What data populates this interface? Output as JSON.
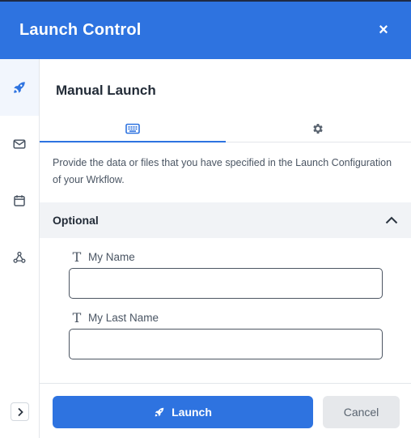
{
  "header": {
    "title": "Launch Control",
    "close_label": "×"
  },
  "sidebar": {
    "items": [
      {
        "icon": "rocket-icon",
        "active": true
      },
      {
        "icon": "mail-icon",
        "active": false
      },
      {
        "icon": "calendar-icon",
        "active": false
      },
      {
        "icon": "webhook-icon",
        "active": false
      }
    ],
    "expand_icon": "chevron-right-icon"
  },
  "main": {
    "title": "Manual Launch",
    "tabs": [
      {
        "icon": "keyboard-icon",
        "active": true
      },
      {
        "icon": "gear-icon",
        "active": false
      }
    ],
    "description": "Provide the data or files that you have specified in the Launch Configuration of your Wrkflow.",
    "section": {
      "title": "Optional",
      "expanded": true,
      "fields": [
        {
          "icon_glyph": "T",
          "label": "My Name",
          "value": "",
          "placeholder": ""
        },
        {
          "icon_glyph": "T",
          "label": "My Last Name",
          "value": "",
          "placeholder": ""
        }
      ]
    }
  },
  "footer": {
    "launch_label": "Launch",
    "cancel_label": "Cancel"
  },
  "colors": {
    "accent": "#2e73e0",
    "header_bg": "#2e73e0",
    "section_bg": "#f1f3f6",
    "cancel_bg": "#e6e8eb"
  }
}
